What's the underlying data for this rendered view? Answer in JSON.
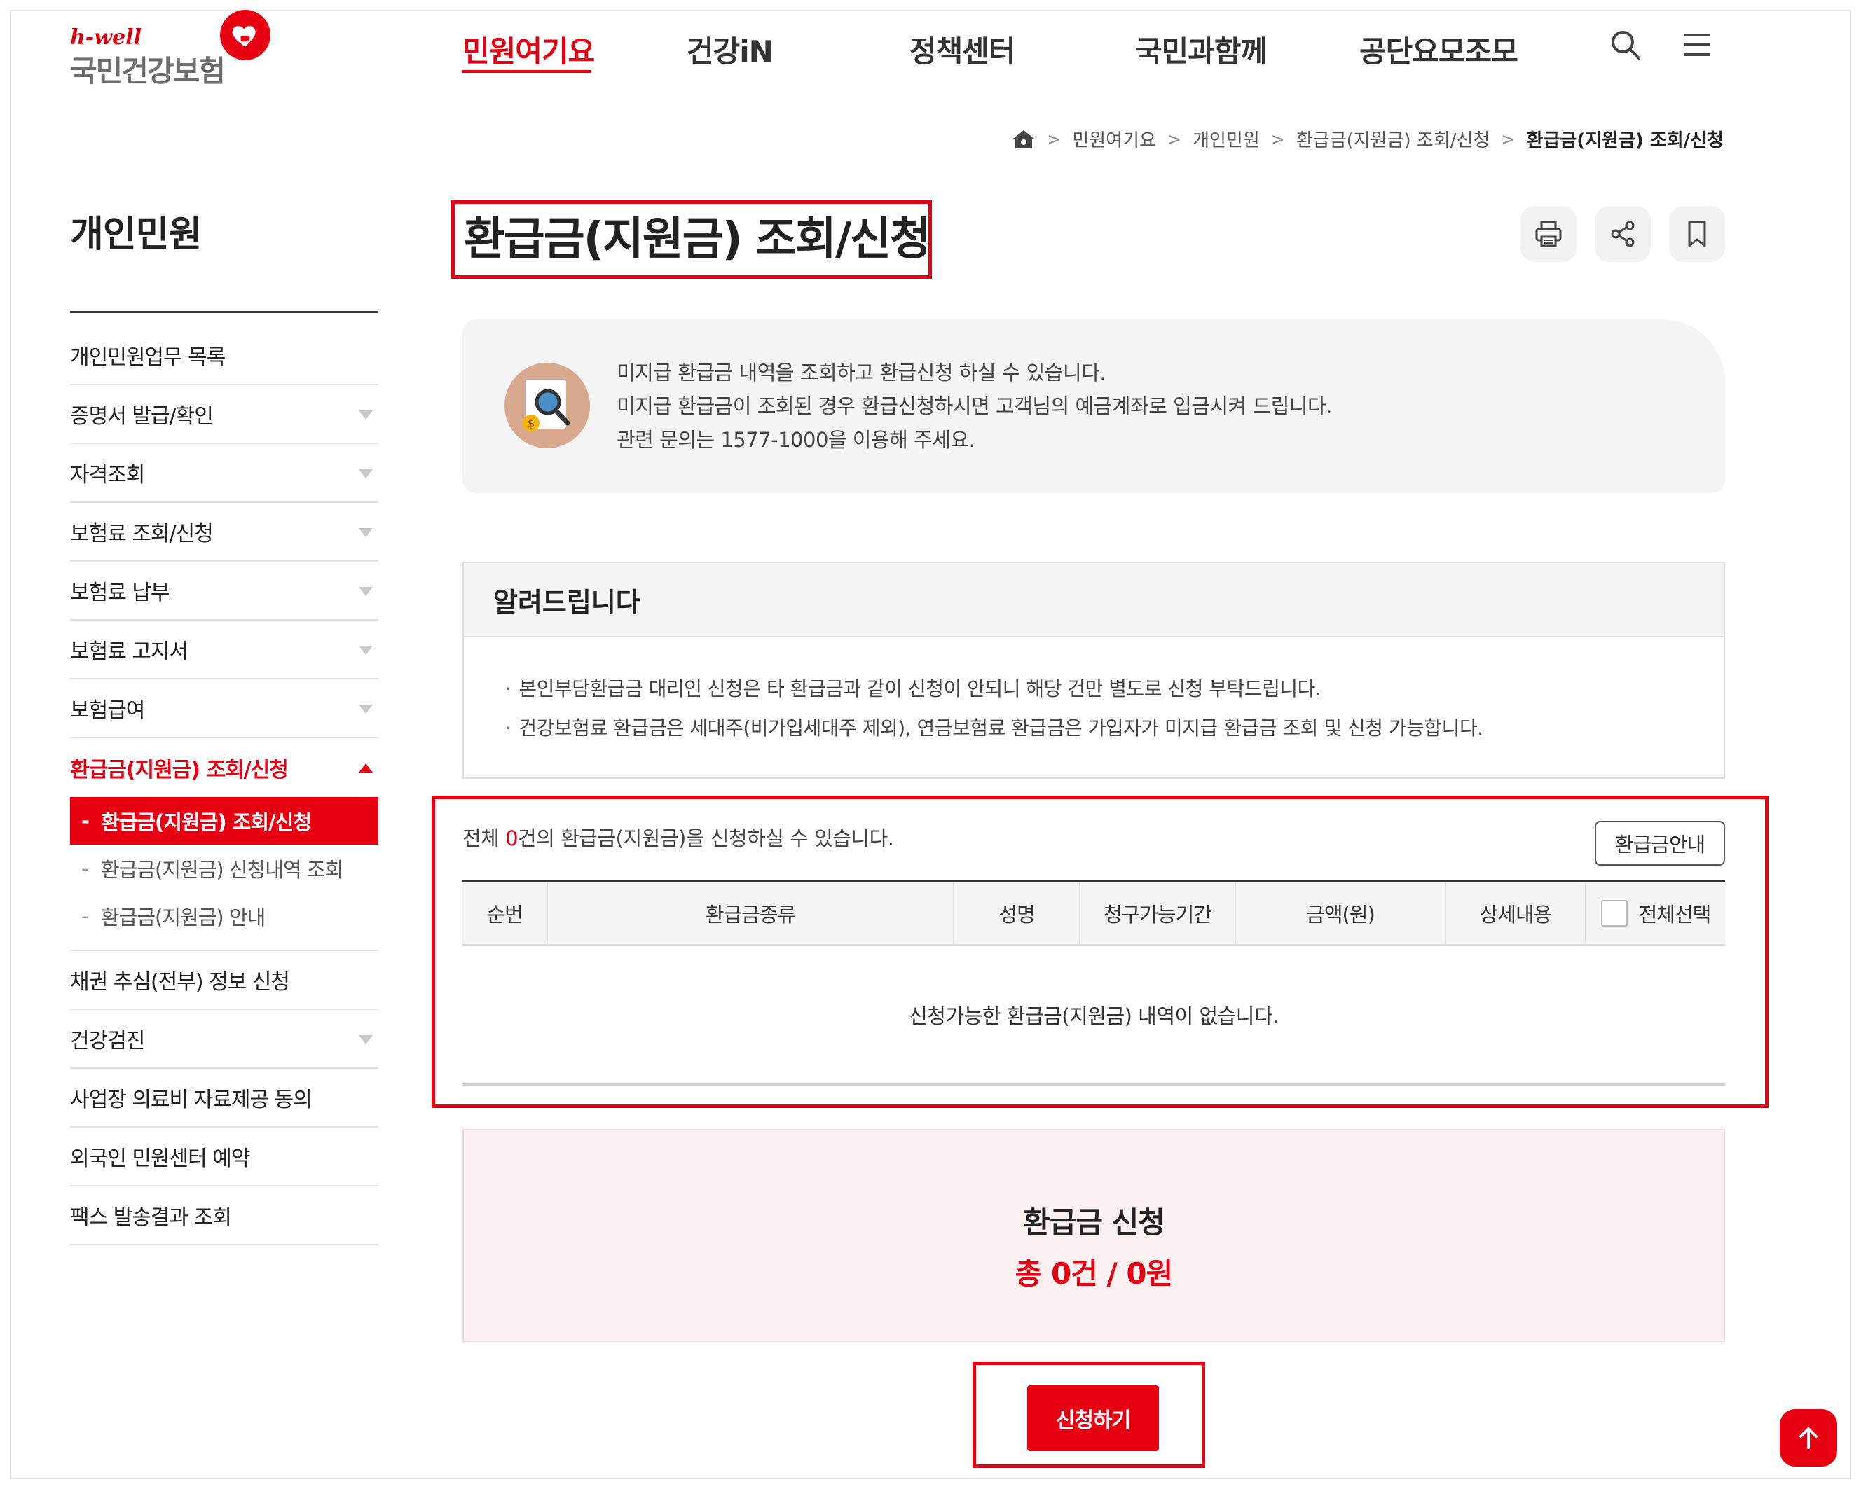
{
  "header": {
    "logo": {
      "brand_small": "h-well",
      "brand_name": "국민건강보험"
    },
    "gnb": [
      {
        "label": "민원여기요",
        "active": true
      },
      {
        "label": "건강iN",
        "active": false
      },
      {
        "label": "정책센터",
        "active": false
      },
      {
        "label": "국민과함께",
        "active": false
      },
      {
        "label": "공단요모조모",
        "active": false
      }
    ],
    "icons": [
      "search-icon",
      "menu-icon"
    ]
  },
  "breadcrumb": [
    "민원여기요",
    "개인민원",
    "환급금(지원금) 조회/신청",
    "환급금(지원금) 조회/신청"
  ],
  "lnb": {
    "title": "개인민원",
    "items": [
      {
        "label": "개인민원업무 목록",
        "has_sub": false
      },
      {
        "label": "증명서 발급/확인",
        "has_sub": true
      },
      {
        "label": "자격조회",
        "has_sub": true
      },
      {
        "label": "보험료 조회/신청",
        "has_sub": true
      },
      {
        "label": "보험료 납부",
        "has_sub": true
      },
      {
        "label": "보험료 고지서",
        "has_sub": true
      },
      {
        "label": "보험급여",
        "has_sub": true
      },
      {
        "label": "환급금(지원금) 조회/신청",
        "open": true
      },
      {
        "label": "채권 추심(전부) 정보 신청",
        "has_sub": false
      },
      {
        "label": "건강검진",
        "has_sub": true
      },
      {
        "label": "사업장 의료비 자료제공 동의",
        "has_sub": false
      },
      {
        "label": "외국인 민원센터 예약",
        "has_sub": false
      },
      {
        "label": "팩스 발송결과 조회",
        "has_sub": false
      }
    ],
    "sub_items": [
      {
        "label": "환급금(지원금) 조회/신청",
        "active": true
      },
      {
        "label": "환급금(지원금) 신청내역 조회",
        "active": false
      },
      {
        "label": "환급금(지원금) 안내",
        "active": false
      }
    ]
  },
  "page": {
    "title": "환급금(지원금) 조회/신청",
    "tools": [
      "print-icon",
      "share-icon",
      "bookmark-icon"
    ]
  },
  "intro": {
    "lines": [
      "미지급 환급금 내역을 조회하고 환급신청 하실 수 있습니다.",
      "미지급 환급금이 조회된 경우 환급신청하시면 고객님의 예금계좌로 입금시켜 드립니다.",
      "관련 문의는 1577-1000을 이용해 주세요."
    ]
  },
  "notice": {
    "title": "알려드립니다",
    "items": [
      "본인부담환급금 대리인 신청은 타 환급금과 같이 신청이 안되니 해당 건만 별도로 신청 부탁드립니다.",
      "건강보험료 환급금은 세대주(비가입세대주 제외), 연금보험료 환급금은 가입자가 미지급 환급금 조회 및 신청 가능합니다."
    ]
  },
  "list": {
    "summary_prefix": "전체 ",
    "count": "0",
    "summary_suffix": "건의 환급금(지원금)을 신청하실 수 있습니다.",
    "guide_button": "환급금안내",
    "columns": [
      "순번",
      "환급금종류",
      "성명",
      "청구가능기간",
      "금액(원)",
      "상세내용",
      "전체선택"
    ],
    "empty_message": "신청가능한 환급금(지원금) 내역이 없습니다."
  },
  "apply": {
    "title": "환급금 신청",
    "total": "총 0건 / 0원",
    "submit_label": "신청하기"
  },
  "colors": {
    "accent": "#e60012",
    "panel": "#f4f4f4",
    "summary_bg": "#fdf0f0"
  }
}
